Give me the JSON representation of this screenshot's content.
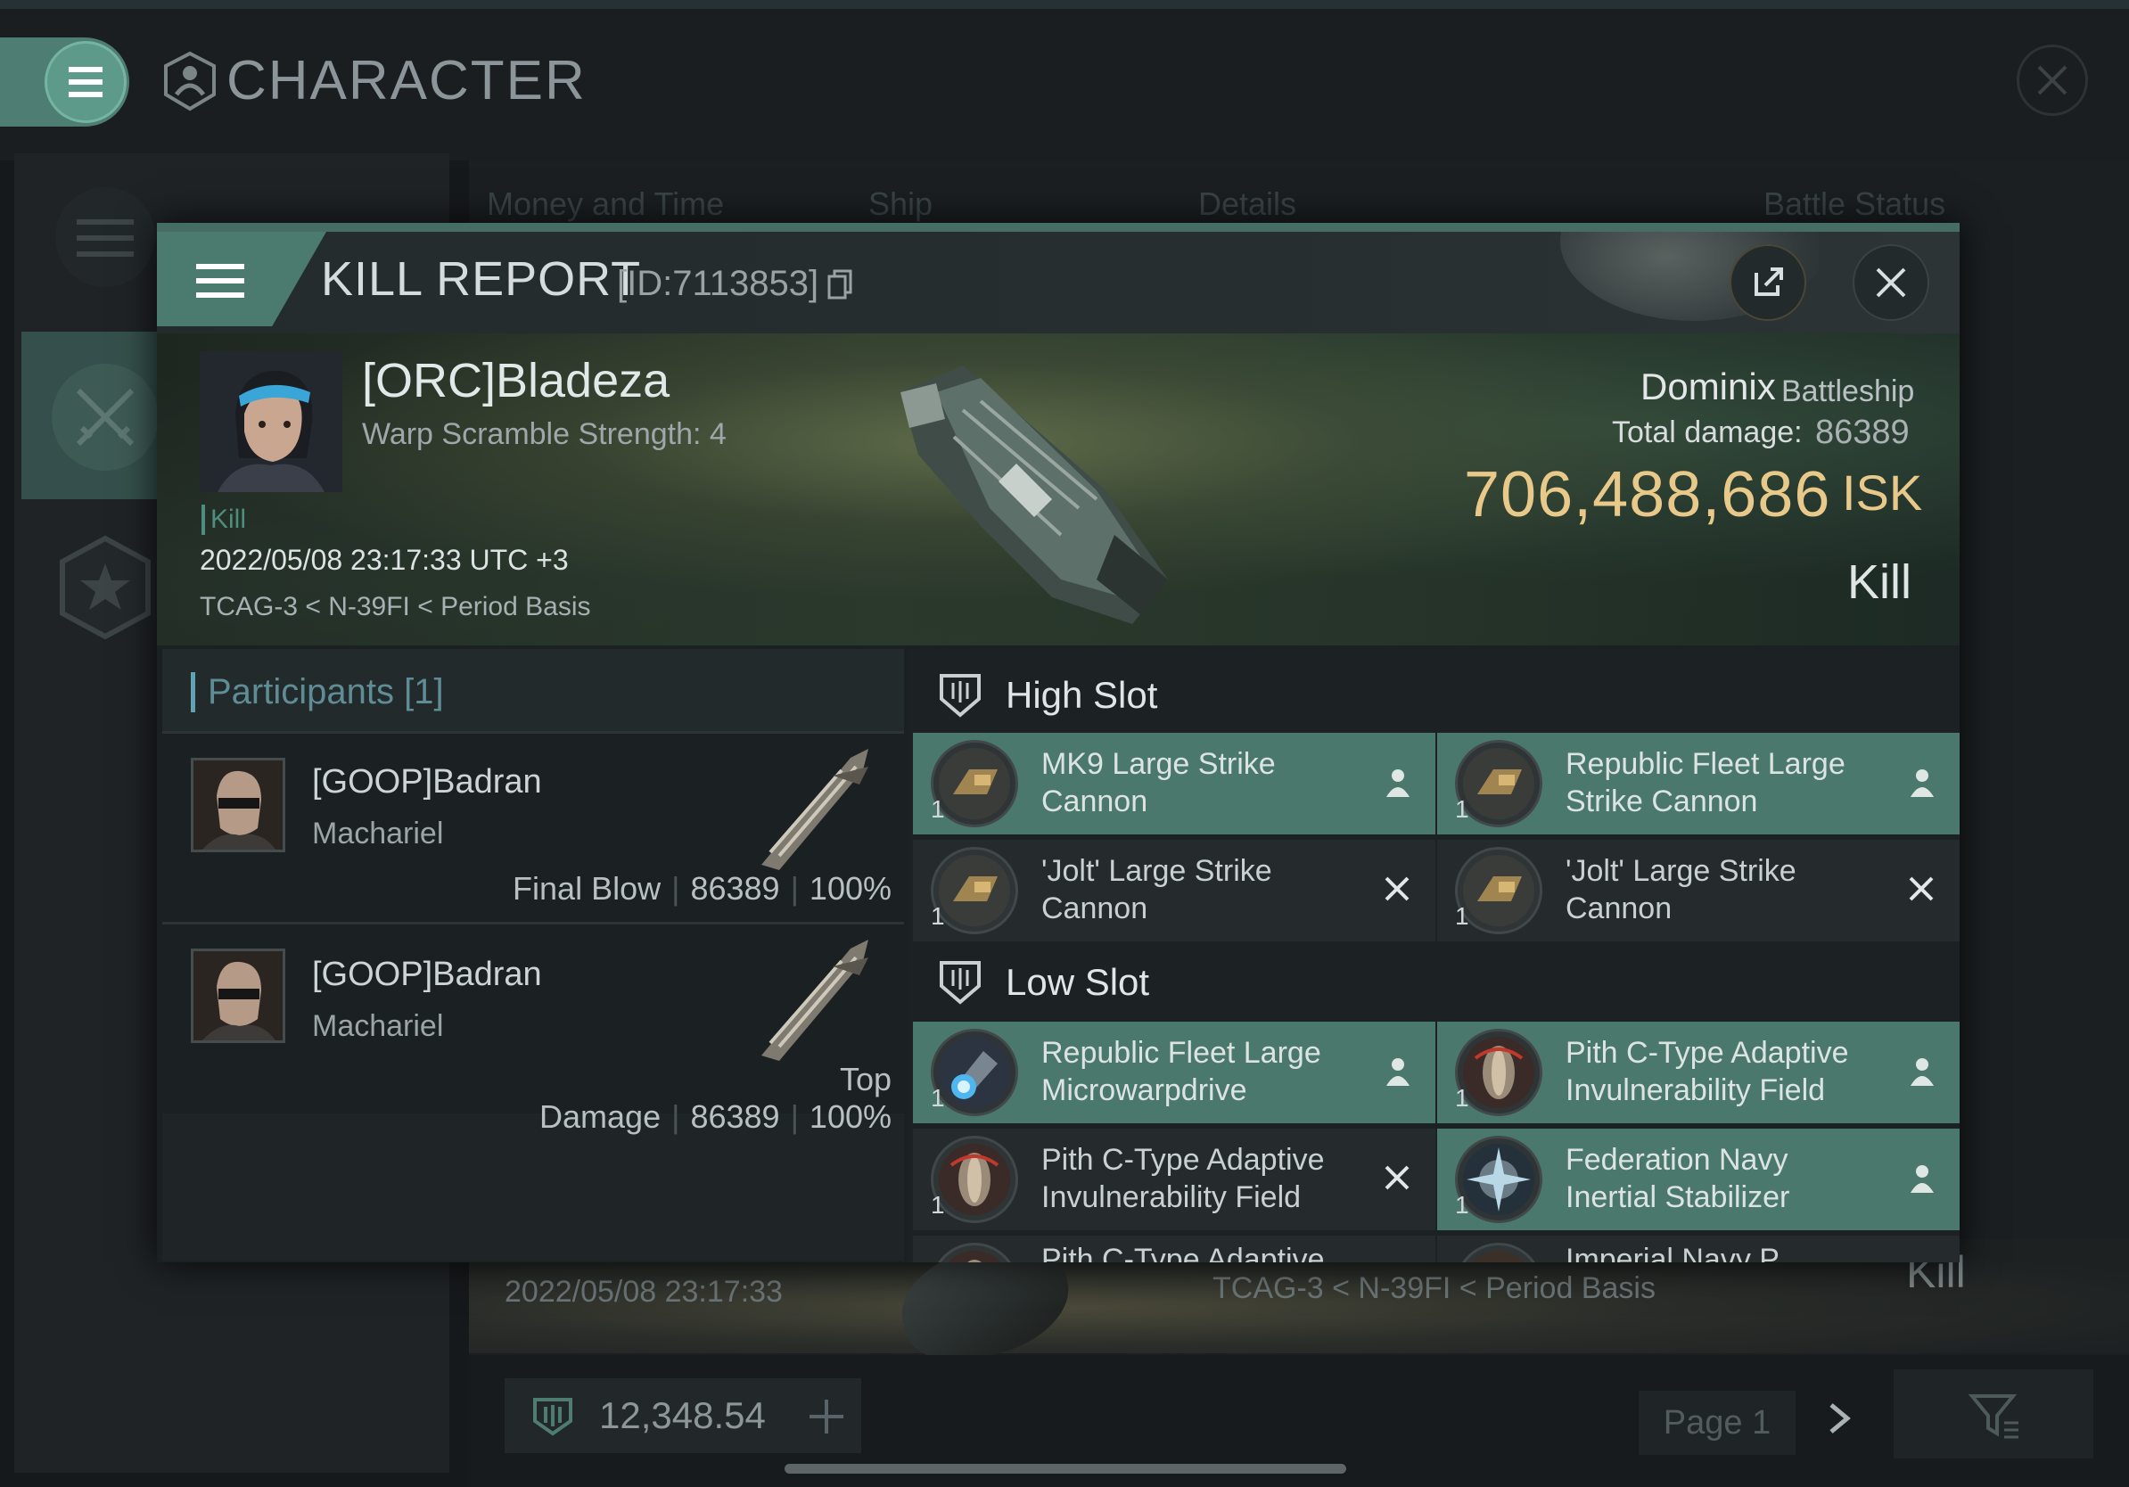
{
  "window": {
    "title": "CHARACTER"
  },
  "background": {
    "columns": [
      "Money and Time",
      "Ship",
      "Details",
      "Battle Status"
    ],
    "row": {
      "datetime": "2022/05/08  23:17:33",
      "location": "TCAG-3 < N-39FI < Period Basis",
      "status": "Kill"
    },
    "balance": "12,348.54",
    "page": "Page 1"
  },
  "kill_report": {
    "title": "KILL REPORT",
    "id": "[ID:7113853]",
    "victim": {
      "name": "[ORC]Bladeza",
      "warp_scramble": "Warp Scramble Strength: 4",
      "tag": "Kill",
      "datetime": "2022/05/08 23:17:33 UTC +3",
      "location": "TCAG-3 < N-39FI < Period Basis"
    },
    "ship": {
      "name": "Dominix",
      "class": "Battleship",
      "total_damage_label": "Total damage:",
      "total_damage": "86389",
      "isk_value": "706,488,686",
      "isk_unit": "ISK",
      "status": "Kill"
    },
    "participants": {
      "title": "Participants",
      "count": "[1]",
      "rows": [
        {
          "name": "[GOOP]Badran",
          "ship": "Machariel",
          "role": "Final Blow",
          "damage": "86389",
          "percent": "100%"
        },
        {
          "name": "[GOOP]Badran",
          "ship": "Machariel",
          "role": "Top Damage",
          "damage": "86389",
          "percent": "100%"
        }
      ]
    },
    "high_slot": {
      "label": "High Slot",
      "items": [
        {
          "name": "MK9 Large Strike Cannon",
          "qty": "1",
          "state": "fitted"
        },
        {
          "name": "Republic Fleet Large Strike Cannon",
          "qty": "1",
          "state": "fitted"
        },
        {
          "name": "'Jolt' Large Strike Cannon",
          "qty": "1",
          "state": "destroyed"
        },
        {
          "name": "'Jolt' Large Strike Cannon",
          "qty": "1",
          "state": "destroyed"
        }
      ]
    },
    "low_slot": {
      "label": "Low Slot",
      "items": [
        {
          "name": "Republic Fleet Large Microwarpdrive",
          "qty": "1",
          "state": "fitted"
        },
        {
          "name": "Pith C-Type Adaptive Invulnerability Field",
          "qty": "1",
          "state": "fitted"
        },
        {
          "name": "Pith C-Type Adaptive Invulnerability Field",
          "qty": "1",
          "state": "destroyed"
        },
        {
          "name": "Federation Navy Inertial Stabilizer",
          "qty": "1",
          "state": "fitted"
        },
        {
          "name": "Pith C-Type Adaptive",
          "qty": "",
          "state": "partial"
        },
        {
          "name": "Imperial Navy P",
          "qty": "",
          "state": "partial"
        }
      ]
    }
  },
  "colors": {
    "accent": "#4b7a6e",
    "isk": "#e8c98a",
    "participants": "#5f8d95"
  },
  "icons": [
    "menu-icon",
    "character-icon",
    "close-icon",
    "share-icon",
    "copy-icon",
    "shield-slot-icon",
    "pilot-icon",
    "destroyed-x-icon",
    "plus-icon",
    "filter-icon",
    "chevron-right-icon",
    "star-icon"
  ]
}
